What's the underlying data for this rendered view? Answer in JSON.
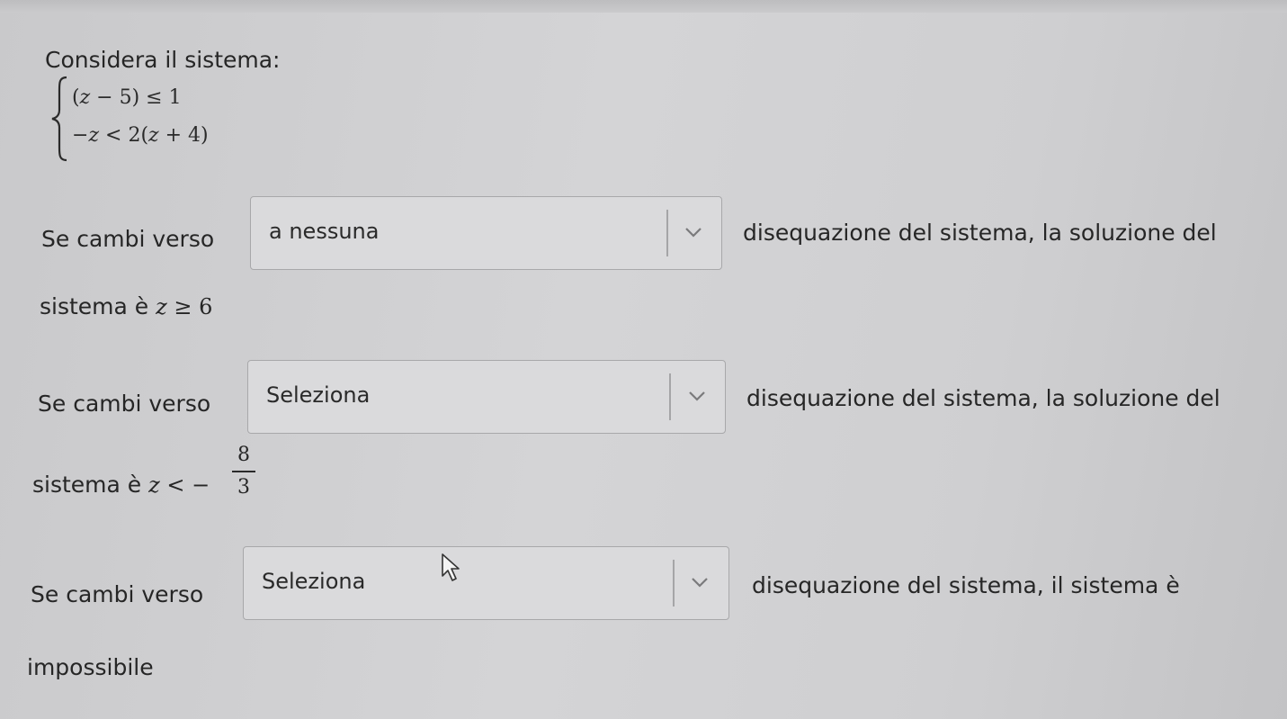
{
  "intro": "Considera il sistema:",
  "system": {
    "eq1_pre": "(",
    "eq1_var": "z",
    "eq1_post": " − 5) ≤ 1",
    "eq2_pre": "−",
    "eq2_var": "z",
    "eq2_mid": " < 2(",
    "eq2_var2": "z",
    "eq2_post": " + 4)"
  },
  "questions": [
    {
      "prefix": "Se cambi verso",
      "select_value": "a nessuna",
      "suffix": "disequazione del sistema, la soluzione del",
      "continuation": "sistema è",
      "math_var": "z",
      "math_rest": " ≥ 6"
    },
    {
      "prefix": "Se cambi verso",
      "select_value": "Seleziona",
      "suffix": "disequazione del sistema, la soluzione del",
      "continuation": "sistema è",
      "math_var": "z",
      "math_rest": " < −",
      "frac_num": "8",
      "frac_den": "3"
    },
    {
      "prefix": "Se cambi verso",
      "select_value": "Seleziona",
      "suffix": "disequazione del sistema, il sistema è",
      "continuation": "impossibile"
    }
  ],
  "icons": {
    "dropdown": "chevron-down-icon",
    "cursor": "mouse-pointer-icon",
    "brace": "left-brace-icon"
  }
}
